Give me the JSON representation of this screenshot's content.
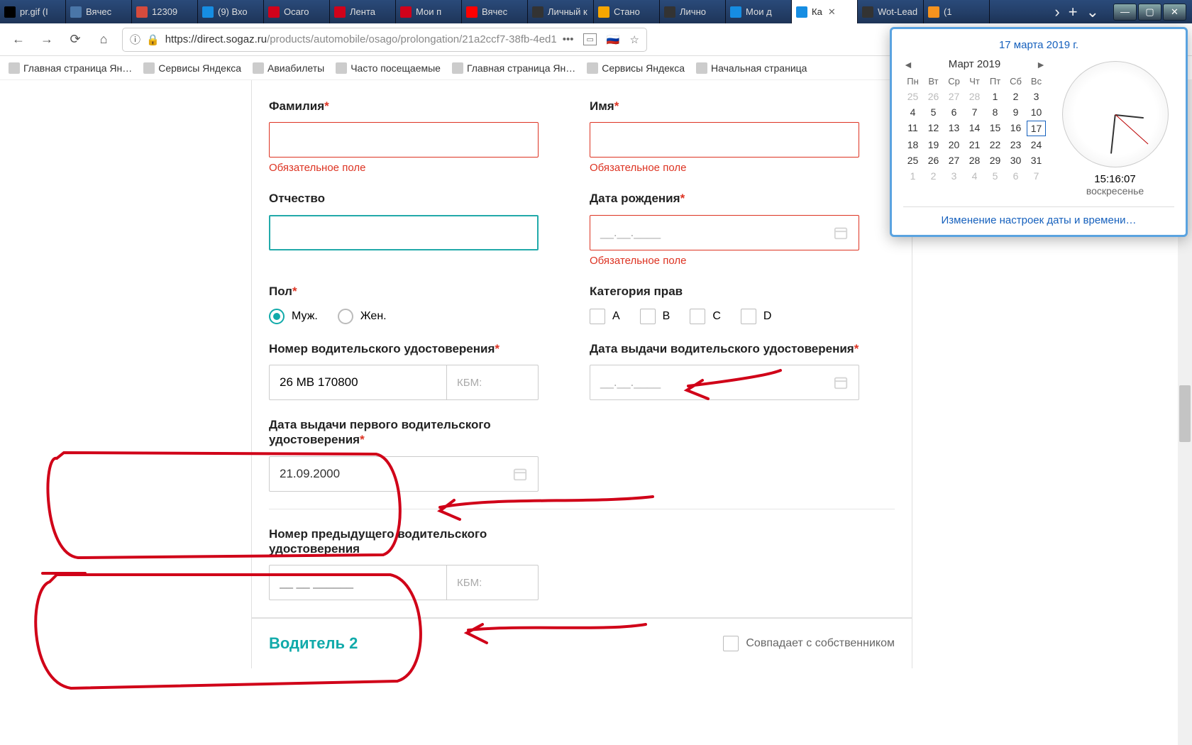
{
  "tabs": [
    {
      "label": "pr.gif (I",
      "favColor": "#000"
    },
    {
      "label": "Вячес",
      "favColor": "#4a76a8"
    },
    {
      "label": "12309",
      "favColor": "#d54b3d"
    },
    {
      "label": "(9) Вхо",
      "favColor": "#168de2"
    },
    {
      "label": "Осаго",
      "favColor": "#d0021b"
    },
    {
      "label": "Лента",
      "favColor": "#d0021b"
    },
    {
      "label": "Мои п",
      "favColor": "#d0021b"
    },
    {
      "label": "Вячес",
      "favColor": "#ff0000"
    },
    {
      "label": "Личный к",
      "favColor": "#333"
    },
    {
      "label": "Стано",
      "favColor": "#f7a600"
    },
    {
      "label": "Лично",
      "favColor": "#333"
    },
    {
      "label": "Мои д",
      "favColor": "#168de2"
    },
    {
      "label": "Ка",
      "favColor": "#168de2",
      "active": true
    },
    {
      "label": "Wot-Lead",
      "favColor": "#333"
    },
    {
      "label": "(1",
      "favColor": "#f7931e"
    }
  ],
  "url": {
    "host": "https://direct.sogaz.ru",
    "path": "/products/automobile/osago/prolongation/21a2ccf7-38fb-4ed1"
  },
  "bookmarks": [
    "Главная страница Ян…",
    "Сервисы Яндекса",
    "Авиабилеты",
    "Часто посещаемые",
    "Главная страница Ян…",
    "Сервисы Яндекса",
    "Начальная страница"
  ],
  "form": {
    "surname": {
      "label": "Фамилия",
      "error": "Обязательное поле"
    },
    "name": {
      "label": "Имя",
      "error": "Обязательное поле"
    },
    "patronymic": {
      "label": "Отчество"
    },
    "dob": {
      "label": "Дата рождения",
      "placeholder": "__.__.____",
      "error": "Обязательное поле"
    },
    "gender": {
      "label": "Пол",
      "opts": [
        "Муж.",
        "Жен."
      ]
    },
    "license_cat": {
      "label": "Категория прав",
      "opts": [
        "A",
        "B",
        "C",
        "D"
      ]
    },
    "license_num": {
      "label": "Номер водительского удостоверения",
      "value": "26 МВ 170800",
      "kbm": "КБМ:"
    },
    "license_date": {
      "label": "Дата выдачи водительского удостоверения",
      "placeholder": "__.__.____"
    },
    "first_license": {
      "label": "Дата выдачи первого водительского удостоверения",
      "value": "21.09.2000"
    },
    "prev_license": {
      "label": "Номер предыдущего водительского удостоверения",
      "placeholder": "__ __ ______",
      "kbm": "КБМ:"
    },
    "driver2": {
      "title": "Водитель 2",
      "owner": "Совпадает с собственником"
    }
  },
  "clock": {
    "fulldate": "17 марта 2019 г.",
    "month": "Март 2019",
    "dayhdr": [
      "Пн",
      "Вт",
      "Ср",
      "Чт",
      "Пт",
      "Сб",
      "Вс"
    ],
    "grid": [
      [
        25,
        26,
        27,
        28,
        1,
        2,
        3
      ],
      [
        4,
        5,
        6,
        7,
        8,
        9,
        10
      ],
      [
        11,
        12,
        13,
        14,
        15,
        16,
        17
      ],
      [
        18,
        19,
        20,
        21,
        22,
        23,
        24
      ],
      [
        25,
        26,
        27,
        28,
        29,
        30,
        31
      ],
      [
        1,
        2,
        3,
        4,
        5,
        6,
        7
      ]
    ],
    "time": "15:16:07",
    "weekday": "воскресенье",
    "link": "Изменение настроек даты и времени…"
  }
}
